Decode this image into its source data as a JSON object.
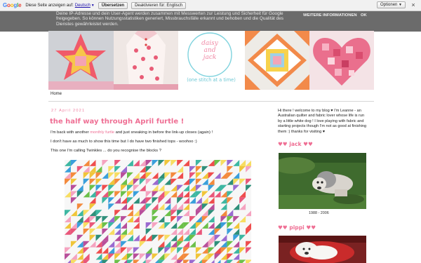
{
  "translate_bar": {
    "logo": "Google",
    "prompt": "Diese Seite anzeigen auf:",
    "language": "Deutsch",
    "translate_label": "Übersetzen",
    "disable_label": "Deaktivieren für: Englisch",
    "options_label": "Optionen",
    "close_glyph": "×"
  },
  "cookie_notice": {
    "message": "Deine IP-Adresse und dein User-Agent werden zusammen mit Messwerten zur Leistung und Sicherheit für Google freigegeben. So können Nutzungsstatistiken generiert, Missbrauchsfälle erkannt und behoben und die Qualität des Dienstes gewährleistet werden.",
    "more_info_label": "WEITERE INFORMATIONEN",
    "ok_label": "OK"
  },
  "header": {
    "logo_lines": [
      "daisy",
      "and",
      "jack"
    ],
    "tagline": "(one stitch at a time)"
  },
  "nav": {
    "home_label": "Home"
  },
  "post": {
    "date": "27 April 2021",
    "title": "the half way through April furtle !",
    "p1_before": "I'm back with another ",
    "p1_link": "monthly furtle",
    "p1_after": " and just sneaking in before the link-up closes (again) !",
    "p2": "I don't have as much to show this time but I do have two finished tops - woohoo :)",
    "p3": "This one I'm calling Twinkles ... do you recognise the blocks ?"
  },
  "sidebar": {
    "intro": "Hi there ! welcome to my blog ♥ I'm Leanne - an Australian quilter and fabric lover whose life is run by a little white dog ! I love playing with fabric and starting projects though I'm not as good at finishing them :) thanks for visiting ♥",
    "jack_heading": "♥♥ jack ♥♥",
    "jack_caption": "1988 - 2006",
    "pippi_heading": "♥♥ pippi ♥♥"
  },
  "colors": {
    "accent_pink": "#ef6f94",
    "cookie_bg": "#6b6b6b",
    "link_blue": "#1a0dab"
  }
}
